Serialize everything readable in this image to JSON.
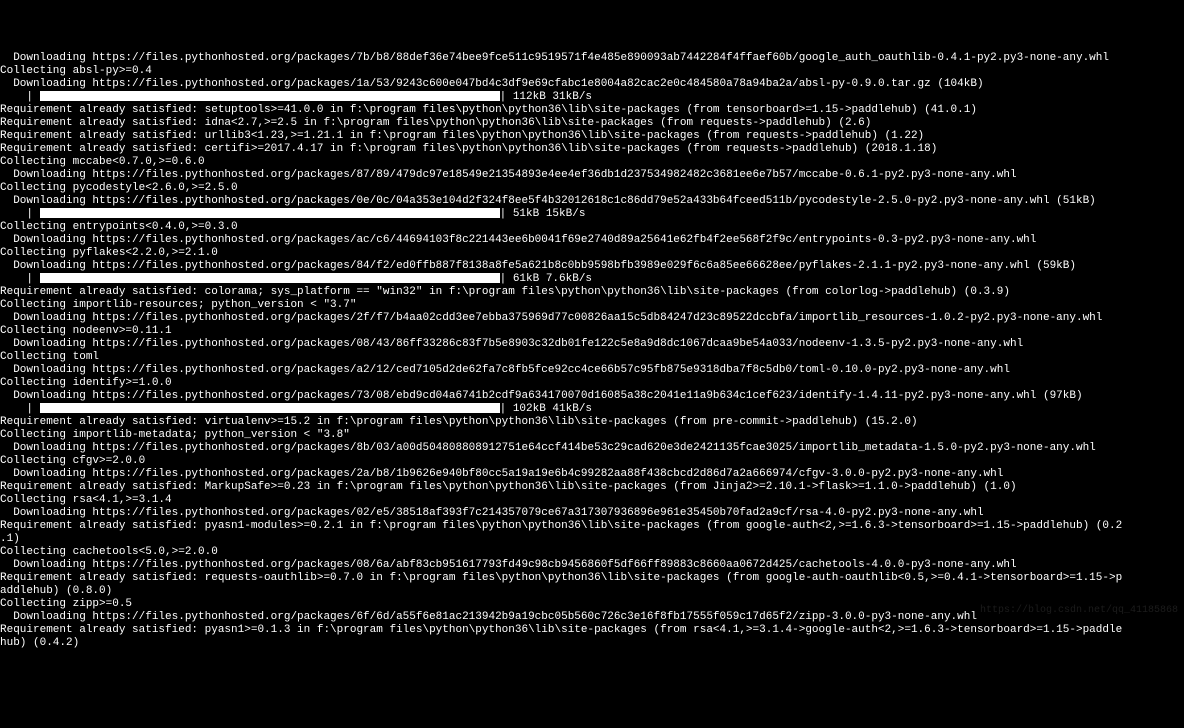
{
  "lines": [
    {
      "t": "  Downloading https://files.pythonhosted.org/packages/7b/b8/88def36e74bee9fce511c9519571f4e485e890093ab7442284f4ffaef60b/google_auth_oauthlib-0.4.1-py2.py3-none-any.whl"
    },
    {
      "t": "Collecting absl-py>=0.4"
    },
    {
      "t": "  Downloading https://files.pythonhosted.org/packages/1a/53/9243c600e047bd4c3df9e69cfabc1e8004a82cac2e0c484580a78a94ba2a/absl-py-0.9.0.tar.gz (104kB)"
    },
    {
      "bar": true,
      "after": " 112kB 31kB/s"
    },
    {
      "t": "Requirement already satisfied: setuptools>=41.0.0 in f:\\program files\\python\\python36\\lib\\site-packages (from tensorboard>=1.15->paddlehub) (41.0.1)"
    },
    {
      "t": "Requirement already satisfied: idna<2.7,>=2.5 in f:\\program files\\python\\python36\\lib\\site-packages (from requests->paddlehub) (2.6)"
    },
    {
      "t": "Requirement already satisfied: urllib3<1.23,>=1.21.1 in f:\\program files\\python\\python36\\lib\\site-packages (from requests->paddlehub) (1.22)"
    },
    {
      "t": "Requirement already satisfied: certifi>=2017.4.17 in f:\\program files\\python\\python36\\lib\\site-packages (from requests->paddlehub) (2018.1.18)"
    },
    {
      "t": "Collecting mccabe<0.7.0,>=0.6.0"
    },
    {
      "t": "  Downloading https://files.pythonhosted.org/packages/87/89/479dc97e18549e21354893e4ee4ef36db1d237534982482c3681ee6e7b57/mccabe-0.6.1-py2.py3-none-any.whl"
    },
    {
      "t": "Collecting pycodestyle<2.6.0,>=2.5.0"
    },
    {
      "t": "  Downloading https://files.pythonhosted.org/packages/0e/0c/04a353e104d2f324f8ee5f4b32012618c1c86dd79e52a433b64fceed511b/pycodestyle-2.5.0-py2.py3-none-any.whl (51kB)"
    },
    {
      "bar": true,
      "after": " 51kB 15kB/s"
    },
    {
      "t": "Collecting entrypoints<0.4.0,>=0.3.0"
    },
    {
      "t": "  Downloading https://files.pythonhosted.org/packages/ac/c6/44694103f8c221443ee6b0041f69e2740d89a25641e62fb4f2ee568f2f9c/entrypoints-0.3-py2.py3-none-any.whl"
    },
    {
      "t": "Collecting pyflakes<2.2.0,>=2.1.0"
    },
    {
      "t": "  Downloading https://files.pythonhosted.org/packages/84/f2/ed0ffb887f8138a8fe5a621b8c0bb9598bfb3989e029f6c6a85ee66628ee/pyflakes-2.1.1-py2.py3-none-any.whl (59kB)"
    },
    {
      "bar": true,
      "after": " 61kB 7.6kB/s"
    },
    {
      "t": "Requirement already satisfied: colorama; sys_platform == \"win32\" in f:\\program files\\python\\python36\\lib\\site-packages (from colorlog->paddlehub) (0.3.9)"
    },
    {
      "t": "Collecting importlib-resources; python_version < \"3.7\""
    },
    {
      "t": "  Downloading https://files.pythonhosted.org/packages/2f/f7/b4aa02cdd3ee7ebba375969d77c00826aa15c5db84247d23c89522dccbfa/importlib_resources-1.0.2-py2.py3-none-any.whl"
    },
    {
      "t": "Collecting nodeenv>=0.11.1"
    },
    {
      "t": "  Downloading https://files.pythonhosted.org/packages/08/43/86ff33286c83f7b5e8903c32db01fe122c5e8a9d8dc1067dcaa9be54a033/nodeenv-1.3.5-py2.py3-none-any.whl"
    },
    {
      "t": "Collecting toml"
    },
    {
      "t": "  Downloading https://files.pythonhosted.org/packages/a2/12/ced7105d2de62fa7c8fb5fce92cc4ce66b57c95fb875e9318dba7f8c5db0/toml-0.10.0-py2.py3-none-any.whl"
    },
    {
      "t": "Collecting identify>=1.0.0"
    },
    {
      "t": "  Downloading https://files.pythonhosted.org/packages/73/08/ebd9cd04a6741b2cdf9a634170070d16085a38c2041e11a9b634c1cef623/identify-1.4.11-py2.py3-none-any.whl (97kB)"
    },
    {
      "bar": true,
      "after": " 102kB 41kB/s"
    },
    {
      "t": "Requirement already satisfied: virtualenv>=15.2 in f:\\program files\\python\\python36\\lib\\site-packages (from pre-commit->paddlehub) (15.2.0)"
    },
    {
      "t": "Collecting importlib-metadata; python_version < \"3.8\""
    },
    {
      "t": "  Downloading https://files.pythonhosted.org/packages/8b/03/a00d504808808912751e64ccf414be53c29cad620e3de2421135fcae3025/importlib_metadata-1.5.0-py2.py3-none-any.whl"
    },
    {
      "t": "Collecting cfgv>=2.0.0"
    },
    {
      "t": "  Downloading https://files.pythonhosted.org/packages/2a/b8/1b9626e940bf80cc5a19a19e6b4c99282aa88f438cbcd2d86d7a2a666974/cfgv-3.0.0-py2.py3-none-any.whl"
    },
    {
      "t": "Requirement already satisfied: MarkupSafe>=0.23 in f:\\program files\\python\\python36\\lib\\site-packages (from Jinja2>=2.10.1->flask>=1.1.0->paddlehub) (1.0)"
    },
    {
      "t": "Collecting rsa<4.1,>=3.1.4"
    },
    {
      "t": "  Downloading https://files.pythonhosted.org/packages/02/e5/38518af393f7c214357079ce67a317307936896e961e35450b70fad2a9cf/rsa-4.0-py2.py3-none-any.whl"
    },
    {
      "t": "Requirement already satisfied: pyasn1-modules>=0.2.1 in f:\\program files\\python\\python36\\lib\\site-packages (from google-auth<2,>=1.6.3->tensorboard>=1.15->paddlehub) (0.2"
    },
    {
      "t": ".1)"
    },
    {
      "t": "Collecting cachetools<5.0,>=2.0.0"
    },
    {
      "t": "  Downloading https://files.pythonhosted.org/packages/08/6a/abf83cb951617793fd49c98cb9456860f5df66ff89883c8660aa0672d425/cachetools-4.0.0-py3-none-any.whl"
    },
    {
      "t": "Requirement already satisfied: requests-oauthlib>=0.7.0 in f:\\program files\\python\\python36\\lib\\site-packages (from google-auth-oauthlib<0.5,>=0.4.1->tensorboard>=1.15->p"
    },
    {
      "t": "addlehub) (0.8.0)"
    },
    {
      "t": "Collecting zipp>=0.5"
    },
    {
      "t": "  Downloading https://files.pythonhosted.org/packages/6f/6d/a55f6e81ac213942b9a19cbc05b560c726c3e16f8fb17555f059c17d65f2/zipp-3.0.0-py3-none-any.whl"
    },
    {
      "t": "Requirement already satisfied: pyasn1>=0.1.3 in f:\\program files\\python\\python36\\lib\\site-packages (from rsa<4.1,>=3.1.4->google-auth<2,>=1.6.3->tensorboard>=1.15->paddle"
    },
    {
      "t": "hub) (0.4.2)"
    }
  ],
  "watermark": "https://blog.csdn.net/qq_41185868"
}
